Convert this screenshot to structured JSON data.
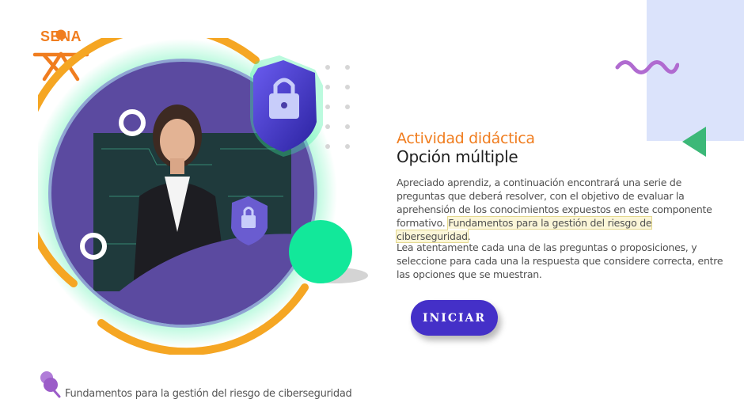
{
  "brand": {
    "logo_text": "SENA",
    "color": "#f07d1f"
  },
  "content": {
    "kicker": "Actividad didáctica",
    "title": "Opción múltiple",
    "paragraph1_text": "Apreciado aprendiz, a continuación encontrará una serie de preguntas que deberá resolver, con el objetivo de evaluar la aprehensión de los conocimientos expuestos en este componente formativo. ",
    "paragraph1_highlight": "Fundamentos para la gestión del riesgo de ciberseguridad",
    "paragraph1_end": ".",
    "paragraph2": "Lea atentamente cada una de las preguntas o proposiciones, y seleccione para cada una la respuesta que considere correcta, entre las opciones que se muestran."
  },
  "start_button": {
    "label": "INICIAR",
    "color": "#4430c8"
  },
  "footer": {
    "icon": "pin-icon",
    "text": "Fundamentos para la gestión del riesgo de ciberseguridad"
  },
  "decor": {
    "accent_purple": "#5b4aa0",
    "accent_orange": "#f5a623",
    "accent_green": "#12e89a",
    "panel_blue": "#dbe3fb",
    "wave_color": "#b06bd0",
    "triangle_color": "#3cb878"
  }
}
